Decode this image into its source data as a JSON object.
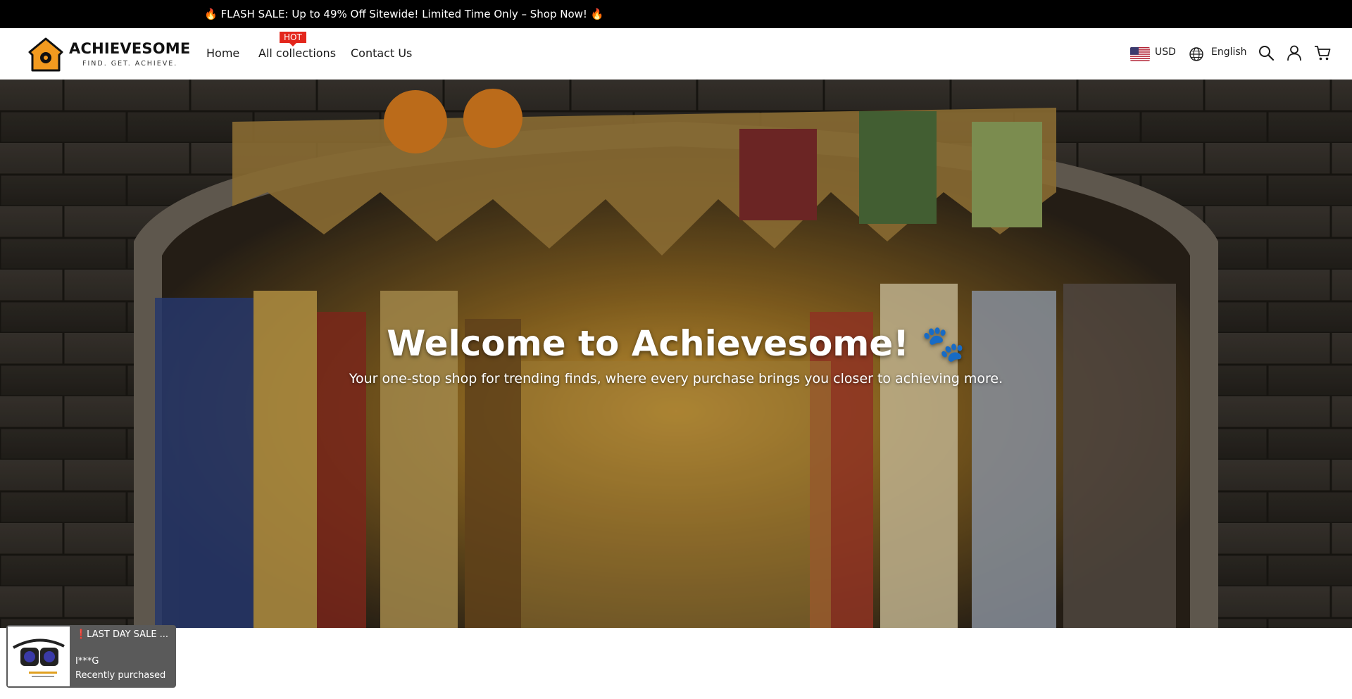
{
  "announcement": {
    "text": "🔥 FLASH SALE: Up to 49% Off Sitewide! Limited Time Only – Shop Now! 🔥"
  },
  "header": {
    "logo": {
      "brand": "ACHIEVESOME",
      "tagline": "FIND. GET. ACHIEVE."
    },
    "nav": {
      "home": "Home",
      "collections": "All collections",
      "collections_badge": "HOT",
      "contact": "Contact Us"
    },
    "currency": "USD",
    "language": "English",
    "icons": [
      "flag-us-icon",
      "globe-icon",
      "search-icon",
      "account-icon",
      "cart-icon"
    ]
  },
  "hero": {
    "title": "Welcome to Achievesome! 🐾",
    "subtitle": "Your one-stop shop for trending finds, where every purchase brings you closer to achieving more."
  },
  "toast": {
    "title": "❗LAST DAY SALE ...",
    "buyer": "I***G",
    "status": "Recently purchased"
  },
  "colors": {
    "announcement_bg": "#000000",
    "badge": "#e3261c",
    "logo_orange": "#f29a1f",
    "toast_bg": "#5a5a5a"
  }
}
